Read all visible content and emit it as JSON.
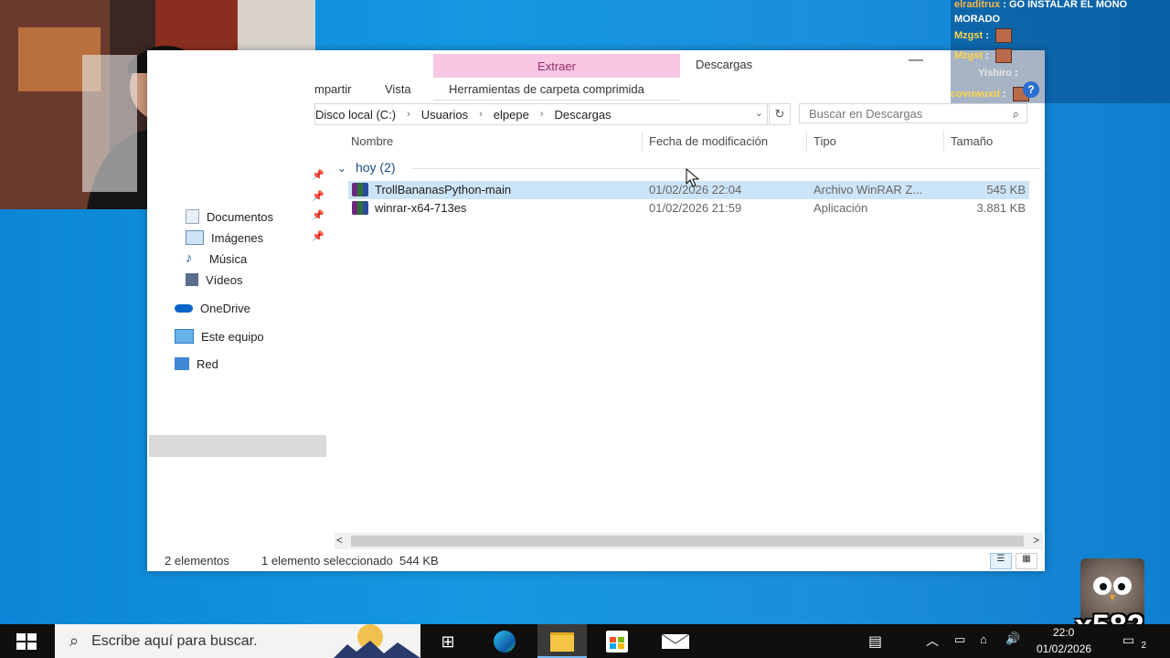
{
  "explorer": {
    "ribbon": {
      "context_tab": "Extraer",
      "tab_share": "mpartir",
      "tab_view": "Vista",
      "context_subtab": "Herramientas de carpeta comprimida",
      "window_title": "Descargas",
      "minimize": "—"
    },
    "address": {
      "crumbs": [
        "Disco local (C:)",
        "Usuarios",
        "elpepe",
        "Descargas"
      ],
      "separator": "›",
      "dropdown": "⌄",
      "refresh": "↻"
    },
    "search": {
      "placeholder": "Buscar en Descargas",
      "icon": "⌕"
    },
    "columns": {
      "name": "Nombre",
      "date": "Fecha de modificación",
      "type": "Tipo",
      "size": "Tamaño"
    },
    "group": {
      "chevron": "⌄",
      "label": "hoy (2)"
    },
    "files": [
      {
        "name": "TrollBananasPython-main",
        "date": "01/02/2026 22:04",
        "type": "Archivo WinRAR Z...",
        "size": "545 KB",
        "selected": true
      },
      {
        "name": "winrar-x64-713es",
        "date": "01/02/2026 21:59",
        "type": "Aplicación",
        "size": "3.881 KB",
        "selected": false
      }
    ],
    "nav": {
      "documents": "Documentos",
      "images": "Imágenes",
      "music": "Música",
      "videos": "Vídeos",
      "onedrive": "OneDrive",
      "this_pc": "Este equipo",
      "network": "Red"
    },
    "status": {
      "count": "2 elementos",
      "selection": "1 elemento seleccionado  544 KB"
    },
    "scroll": {
      "left": "<",
      "right": ">"
    }
  },
  "chat": {
    "line1_user": "elraditrux",
    "line1_text": "GO INSTALAR EL MONO MORADO",
    "line2_user": "Mzgst",
    "line3_user": "Mzgst",
    "line4_user": "Yishiro",
    "line5_user": "covuwuxd",
    "colon": ":",
    "help": "?"
  },
  "overlay": {
    "counter": "x582"
  },
  "taskbar": {
    "search_placeholder": "Escribe aquí para buscar.",
    "time": "22:0",
    "date": "01/02/2026",
    "notifications": "2"
  }
}
